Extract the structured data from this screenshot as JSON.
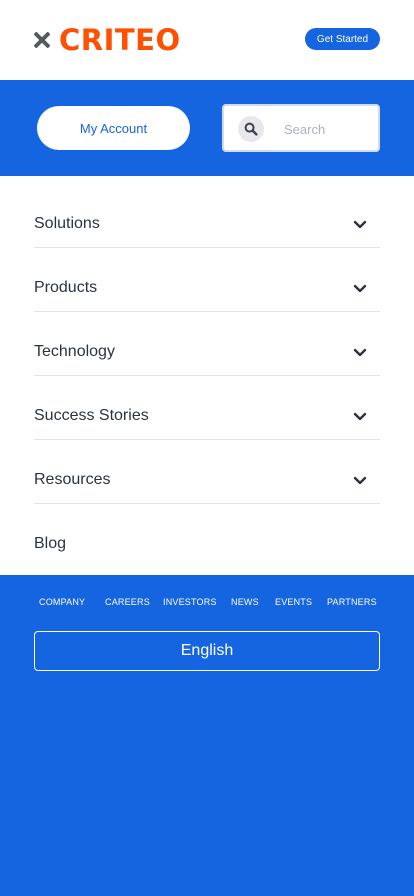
{
  "header": {
    "logo_text": "CRITEO",
    "get_started_label": "Get Started"
  },
  "account_bar": {
    "my_account_label": "My Account",
    "search_placeholder": "Search"
  },
  "menu": {
    "items": [
      {
        "label": "Solutions",
        "has_dropdown": true
      },
      {
        "label": "Products",
        "has_dropdown": true
      },
      {
        "label": "Technology",
        "has_dropdown": true
      },
      {
        "label": "Success Stories",
        "has_dropdown": true
      },
      {
        "label": "Resources",
        "has_dropdown": true
      },
      {
        "label": "Blog",
        "has_dropdown": false
      }
    ]
  },
  "footer": {
    "links": [
      "COMPANY",
      "CAREERS",
      "INVESTORS",
      "NEWS",
      "EVENTS",
      "PARTNERS"
    ],
    "language": "English"
  },
  "colors": {
    "brand_orange": "#fe5000",
    "brand_blue": "#1565e0",
    "text_dark": "#2b3340"
  },
  "icons": {
    "close": "close-icon",
    "search": "search-icon",
    "chevron": "chevron-down-icon"
  }
}
